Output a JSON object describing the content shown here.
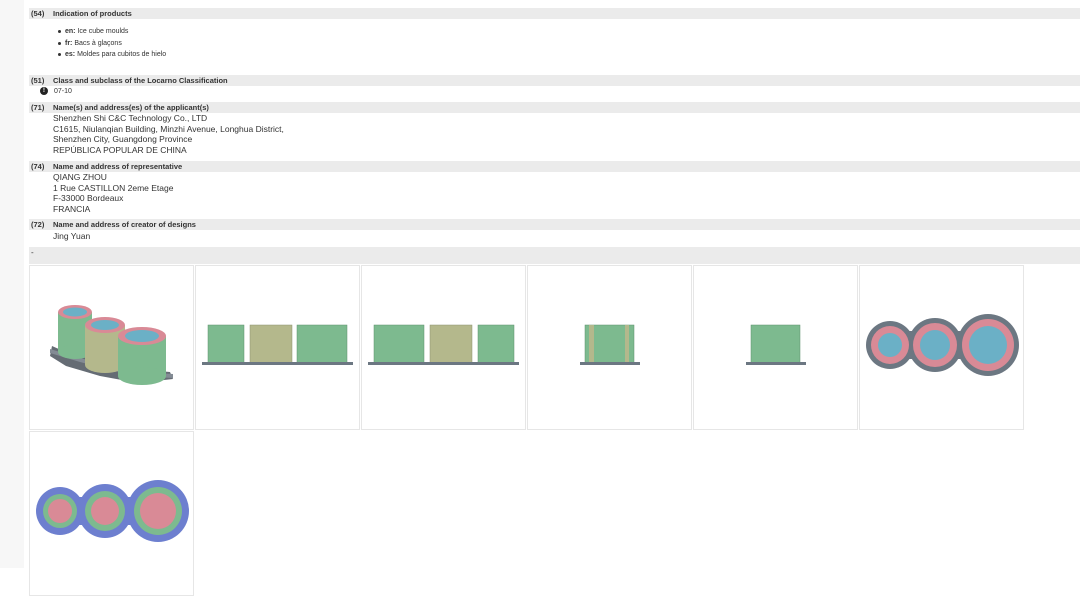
{
  "section_54": {
    "code": "(54)",
    "title": "Indication of products",
    "items": [
      {
        "lang": "en:",
        "text": "Ice cube moulds"
      },
      {
        "lang": "fr:",
        "text": "Bacs à glaçons"
      },
      {
        "lang": "es:",
        "text": "Moldes para cubitos de hielo"
      }
    ]
  },
  "section_51": {
    "code": "(51)",
    "title": "Class and subclass of the Locarno Classification",
    "value": "07-10"
  },
  "section_71": {
    "code": "(71)",
    "title": "Name(s) and address(es) of the applicant(s)",
    "lines": [
      "Shenzhen Shi C&C Technology Co., LTD",
      "C1615, Niulanqian Building, Minzhi Avenue, Longhua District,",
      "Shenzhen City, Guangdong Province",
      "REPÚBLICA POPULAR DE CHINA"
    ]
  },
  "section_74": {
    "code": "(74)",
    "title": "Name and address of representative",
    "lines": [
      "QIANG ZHOU",
      "1 Rue CASTILLON 2eme Etage",
      "F-33000 Bordeaux",
      "FRANCIA"
    ]
  },
  "section_72": {
    "code": "(72)",
    "title": "Name and address of creator of designs",
    "lines": [
      "Jing Yuan"
    ]
  },
  "views_bar": {
    "text": "-"
  },
  "icons": {
    "info": "info-circle-icon"
  },
  "colors": {
    "header_bg": "#ebebeb",
    "mould_green": "#7dba8f",
    "mould_olive": "#b4b88c",
    "mould_pink": "#d98a96",
    "mould_blue": "#6bb0c6",
    "mould_base": "#6c7782",
    "mould_purple": "#6d7fcf"
  }
}
